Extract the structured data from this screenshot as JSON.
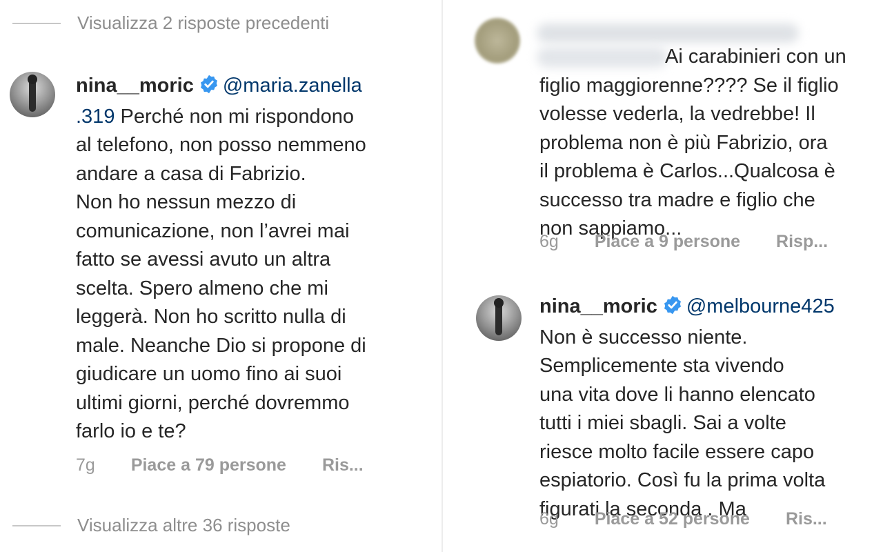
{
  "left": {
    "view_previous": "Visualizza 2 risposte precedenti",
    "comment": {
      "username": "nina__moric",
      "mention_line1": "@maria.zanella",
      "mention_line2": ".319",
      "text_line1": " Perché non mi rispondono",
      "lines": [
        "al telefono, non posso nemmeno",
        "andare a casa di Fabrizio.",
        "Non ho nessun mezzo di",
        "comunicazione, non l’avrei mai",
        "fatto  se avessi avuto un altra",
        "scelta. Spero almeno che mi",
        "leggerà. Non ho scritto nulla di",
        "male. Neanche Dio si propone di",
        "giudicare un uomo fino ai suoi",
        "ultimi giorni, perché dovremmo",
        "farlo io e te?"
      ],
      "time": "7g",
      "likes": "Piace a 79 persone",
      "reply": "Ris..."
    },
    "view_more": "Visualizza altre 36 risposte"
  },
  "right": {
    "comment1": {
      "first_line": "Ai carabinieri con un",
      "lines": [
        "figlio maggiorenne???? Se il figlio",
        "volesse vederla, la vedrebbe! Il",
        "problema non è più Fabrizio, ora",
        "il problema è Carlos...Qualcosa è",
        "successo tra madre e figlio che",
        "non sappiamo..."
      ],
      "time": "6g",
      "likes": "Piace a 9 persone",
      "reply": "Risp..."
    },
    "comment2": {
      "username": "nina__moric",
      "mention": "@melbourne425",
      "lines": [
        "Non è successo niente.",
        "Semplicemente sta vivendo",
        "una vita dove li hanno elencato",
        "tutti i miei sbagli. Sai a volte",
        "riesce molto facile essere capo",
        "espiatorio. Così fu la prima volta",
        "figurati la seconda . Ma"
      ],
      "time": "6g",
      "likes": "Piace a 52 persone",
      "reply": "Ris..."
    }
  },
  "colors": {
    "text": "#262626",
    "mention": "#00376b",
    "secondary": "#8e8e8e",
    "verified": "#3897f0"
  }
}
